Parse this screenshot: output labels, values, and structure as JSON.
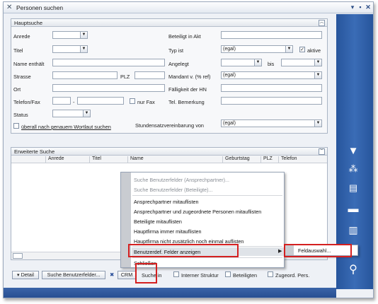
{
  "window": {
    "title": "Personen suchen"
  },
  "hauptsuche": {
    "title": "Hauptsuche",
    "anrede_label": "Anrede",
    "titel_label": "Titel",
    "name_label": "Name enthält",
    "strasse_label": "Strasse",
    "plz_label": "PLZ",
    "ort_label": "Ort",
    "telefon_label": "Telefon/Fax",
    "telefon_sep": "-",
    "nur_fax_label": "nur Fax",
    "status_label": "Status",
    "ueberall_label": "überall nach genauem Wortlaut suchen",
    "beteiligt_label": "Beteiligt in Akt",
    "typ_label": "Typ ist",
    "typ_value": "(egal)",
    "aktive_label": "aktive",
    "angelegt_label": "Angelegt",
    "bis_label": "bis",
    "mandant_label": "Mandant v. (% ref)",
    "mandant_value": "(egal)",
    "faelligkeit_label": "Fälligkeit der HN",
    "tel_bem_label": "Tel. Bemerkung",
    "stundensatz_label": "Stundensatzvereinbarung von",
    "stundensatz_value": "(egal)"
  },
  "erweiterte": {
    "title": "Erweiterte Suche"
  },
  "grid": {
    "columns": [
      "Anrede",
      "Titel",
      "Name",
      "Geburtstag",
      "PLZ",
      "Telefon"
    ]
  },
  "bottom": {
    "detail": "Detail",
    "suche_benutzerfelder": "Suche Benutzerfelder...",
    "crm": "CRM",
    "suche_in": "Suche in",
    "interner_struktur": "Interner Struktur",
    "beteiligten": "Beteiligten",
    "zugeord_pers": "Zugeord. Pers."
  },
  "context_menu": {
    "items": [
      "Suche Benutzerfelder (Ansprechpartner)...",
      "Suche Benutzerfelder (Beteiligte)...",
      "Ansprechpartner mitauflisten",
      "Ansprechpartner und zugeordnete Personen mitauflisten",
      "Beteiligte mitauflisten",
      "Hauptfirma immer mitauflisten",
      "Hauptfirma nicht zusätzlich noch einmal auflisten",
      "Benutzerdef. Felder anzeigen",
      "Schließen"
    ]
  },
  "submenu": {
    "item": "Feldauswahl..."
  },
  "colors": {
    "accent_blue": "#2c5aa0",
    "highlight_red": "#d42020"
  },
  "icons": [
    "tool-icon",
    "pin-icon",
    "restore-icon",
    "close-icon",
    "filter-icon",
    "tree-icon",
    "document-icon",
    "printer-icon",
    "trash-icon",
    "search-icon"
  ]
}
